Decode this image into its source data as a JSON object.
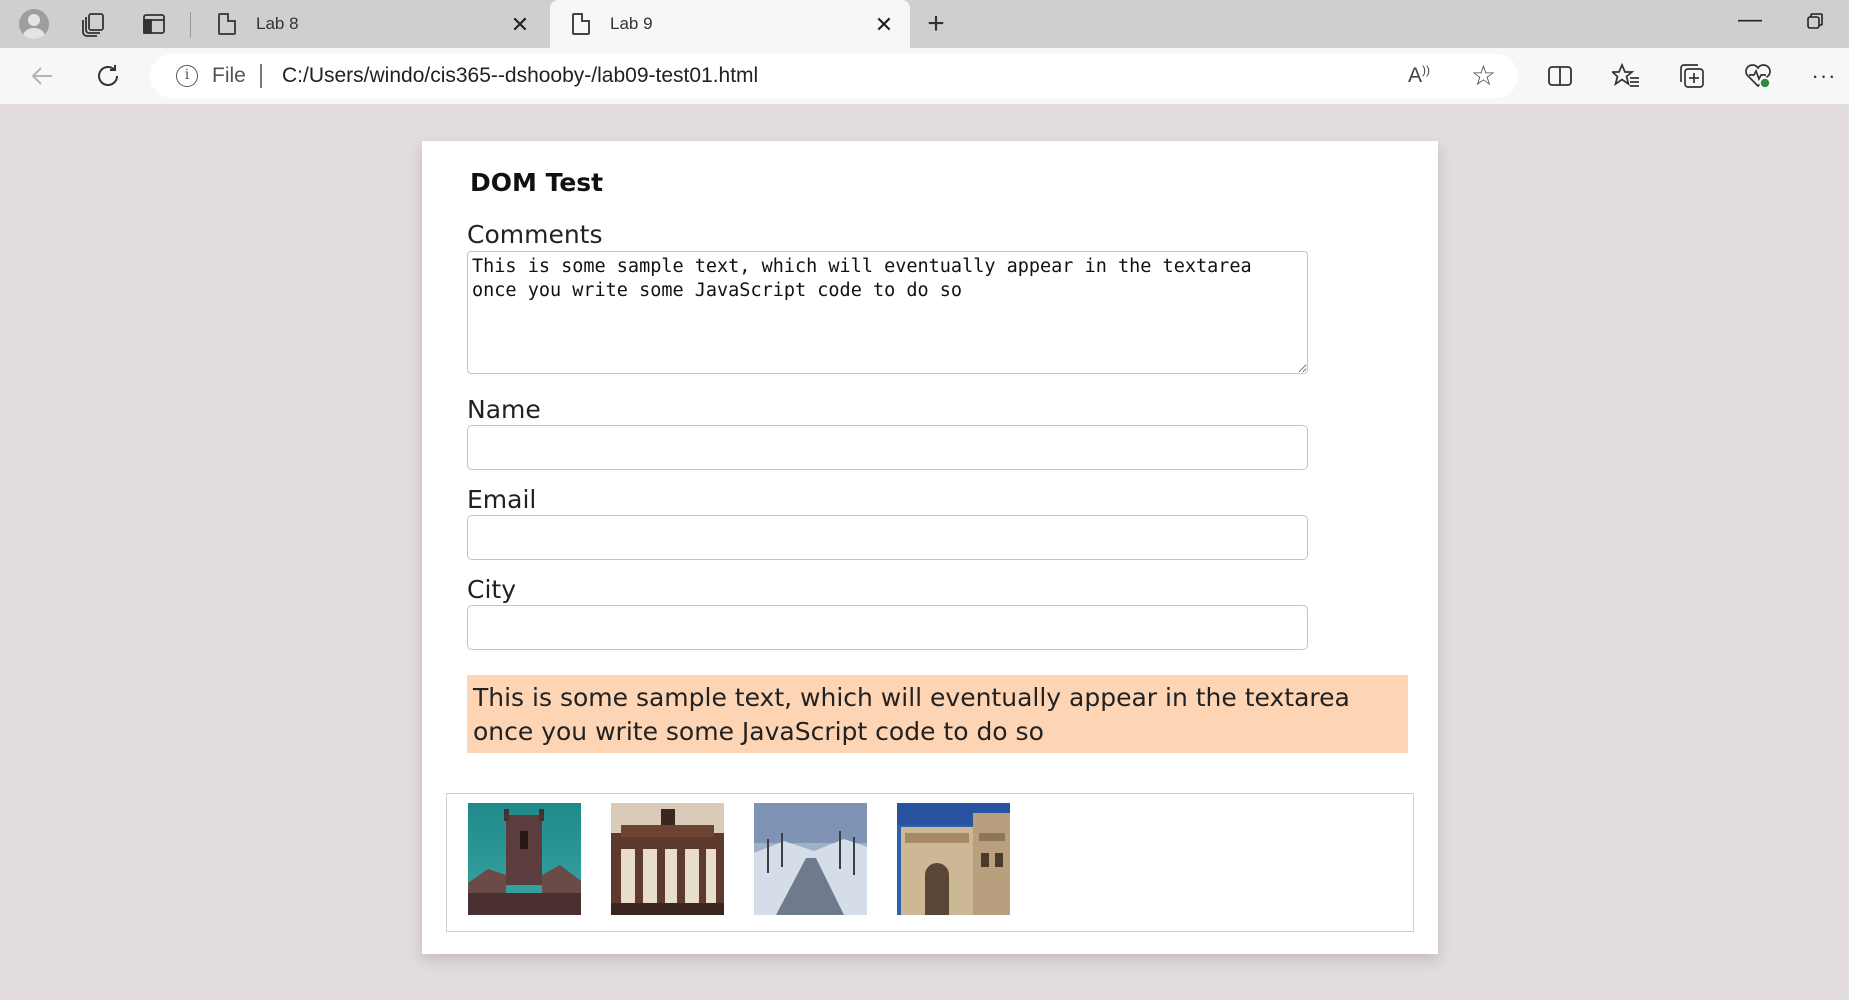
{
  "browser": {
    "tabs": [
      {
        "title": "Lab 8",
        "active": false
      },
      {
        "title": "Lab 9",
        "active": true
      }
    ],
    "address": {
      "scheme_label": "File",
      "url": "C:/Users/windo/cis365--dshooby-/lab09-test01.html"
    },
    "read_aloud_label": "A"
  },
  "page": {
    "title": "DOM Test",
    "comments": {
      "label": "Comments",
      "value": "This is some sample text, which will eventually appear in the textarea once you write some JavaScript code to do so"
    },
    "name": {
      "label": "Name",
      "value": ""
    },
    "email": {
      "label": "Email",
      "value": ""
    },
    "city": {
      "label": "City",
      "value": ""
    },
    "output_text": "This is some sample text, which will eventually appear in the textarea once you write some JavaScript code to do so",
    "output_bg": "#fdd5b5",
    "thumbnails": [
      {
        "subject": "church-tower"
      },
      {
        "subject": "brandenburg-gate"
      },
      {
        "subject": "snowy-road"
      },
      {
        "subject": "arch-of-septimius-severus"
      }
    ]
  }
}
